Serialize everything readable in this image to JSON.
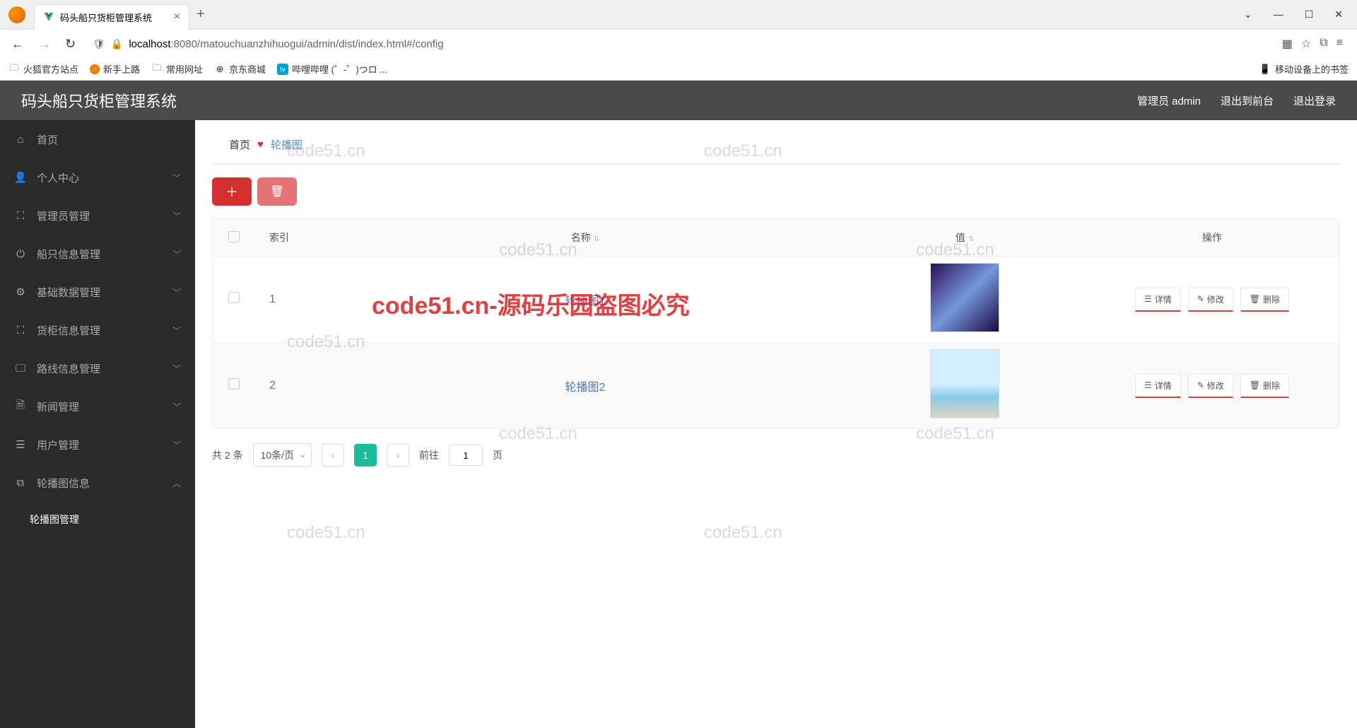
{
  "browser": {
    "tab_title": "码头船只货柜管理系统",
    "url_host": "localhost",
    "url_path": ":8080/matouchuanzhihuogui/admin/dist/index.html#/config",
    "bookmarks": [
      "火狐官方站点",
      "新手上路",
      "常用网址",
      "京东商城",
      "哔哩哔哩 (゜-゜)つロ ..."
    ],
    "mobile_bookmarks": "移动设备上的书签"
  },
  "header": {
    "title": "码头船只货柜管理系统",
    "admin_label": "管理员 admin",
    "logout_front": "退出到前台",
    "logout": "退出登录"
  },
  "sidebar": {
    "items": [
      {
        "label": "首页",
        "icon": "home"
      },
      {
        "label": "个人中心",
        "icon": "user",
        "arrow": true
      },
      {
        "label": "管理员管理",
        "icon": "crop",
        "arrow": true
      },
      {
        "label": "船只信息管理",
        "icon": "power",
        "arrow": true
      },
      {
        "label": "基础数据管理",
        "icon": "gear",
        "arrow": true
      },
      {
        "label": "货柜信息管理",
        "icon": "fullscreen",
        "arrow": true
      },
      {
        "label": "路线信息管理",
        "icon": "monitor",
        "arrow": true
      },
      {
        "label": "新闻管理",
        "icon": "doc",
        "arrow": true
      },
      {
        "label": "用户管理",
        "icon": "list",
        "arrow": true
      },
      {
        "label": "轮播图信息",
        "icon": "copy",
        "arrow": true,
        "expanded": true
      }
    ],
    "submenu_label": "轮播图管理"
  },
  "breadcrumb": {
    "home": "首页",
    "current": "轮播图"
  },
  "table": {
    "columns": {
      "index": "索引",
      "name": "名称",
      "value": "值",
      "ops": "操作"
    },
    "rows": [
      {
        "index": "1",
        "name": "轮播图1",
        "thumb": "galaxy"
      },
      {
        "index": "2",
        "name": "轮播图2",
        "thumb": "ocean"
      }
    ],
    "op_detail": "详情",
    "op_edit": "修改",
    "op_delete": "删除"
  },
  "pagination": {
    "total_prefix": "共",
    "total_count": "2",
    "total_suffix": "条",
    "page_size": "10条/页",
    "current_page": "1",
    "goto_label": "前往",
    "page_suffix": "页"
  },
  "watermarks": {
    "text": "code51.cn",
    "red": "code51.cn-源码乐园盗图必究"
  }
}
